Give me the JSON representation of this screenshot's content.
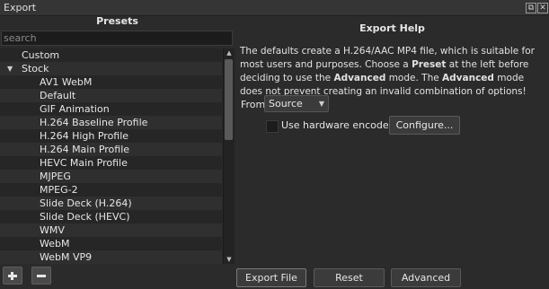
{
  "window": {
    "title": "Export"
  },
  "presets": {
    "header": "Presets",
    "search_placeholder": "search",
    "items": [
      {
        "label": "Custom",
        "level": 0
      },
      {
        "label": "Stock",
        "level": 0,
        "expanded": true
      },
      {
        "label": "AV1 WebM",
        "level": 1
      },
      {
        "label": "Default",
        "level": 1
      },
      {
        "label": "GIF Animation",
        "level": 1
      },
      {
        "label": "H.264 Baseline Profile",
        "level": 1
      },
      {
        "label": "H.264 High Profile",
        "level": 1
      },
      {
        "label": "H.264 Main Profile",
        "level": 1
      },
      {
        "label": "HEVC Main Profile",
        "level": 1
      },
      {
        "label": "MJPEG",
        "level": 1
      },
      {
        "label": "MPEG-2",
        "level": 1
      },
      {
        "label": "Slide Deck (H.264)",
        "level": 1
      },
      {
        "label": "Slide Deck (HEVC)",
        "level": 1
      },
      {
        "label": "WMV",
        "level": 1
      },
      {
        "label": "WebM",
        "level": 1
      },
      {
        "label": "WebM VP9",
        "level": 1
      }
    ]
  },
  "help": {
    "header": "Export Help",
    "text_parts": [
      "The defaults create a H.264/AAC MP4 file, which is suitable for most users and purposes. Choose a ",
      "Preset",
      " at the left before deciding to use the ",
      "Advanced",
      " mode. The ",
      "Advanced",
      " mode does not prevent creating an invalid combination of options!"
    ]
  },
  "from": {
    "label": "From",
    "value": "Source"
  },
  "hardware": {
    "label": "Use hardware encoder",
    "checked": false
  },
  "buttons": {
    "configure": "Configure...",
    "export_file": "Export File",
    "reset": "Reset",
    "advanced": "Advanced"
  },
  "icons": {
    "float": "float-icon",
    "close": "close-icon",
    "expand": "expand-arrow-icon",
    "scroll_up": "scroll-up-icon",
    "scroll_down": "scroll-down-icon",
    "add": "plus-icon",
    "remove": "minus-icon",
    "dropdown": "dropdown-caret-icon"
  }
}
